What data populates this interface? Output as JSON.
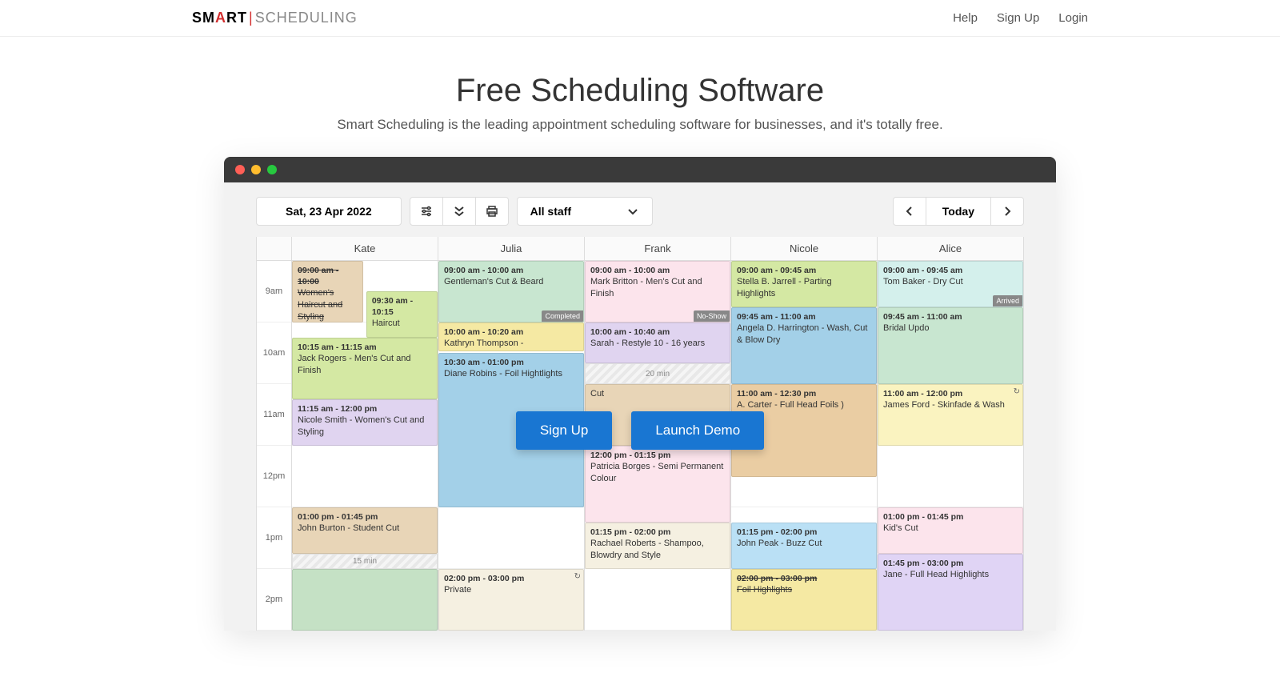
{
  "nav": {
    "help": "Help",
    "signup": "Sign Up",
    "login": "Login"
  },
  "logo": {
    "sm": "SM",
    "a": "A",
    "rt": "RT",
    "div": "|",
    "sched": "SCHEDULING"
  },
  "hero": {
    "title": "Free Scheduling Software",
    "subtitle": "Smart Scheduling is the leading appointment scheduling software for businesses, and it's totally free."
  },
  "toolbar": {
    "date": "Sat, 23 Apr 2022",
    "staff": "All staff",
    "today": "Today"
  },
  "cta": {
    "signup": "Sign Up",
    "demo": "Launch Demo"
  },
  "times": [
    "9am",
    "10am",
    "11am",
    "12pm",
    "1pm",
    "2pm"
  ],
  "staff": [
    "Kate",
    "Julia",
    "Frank",
    "Nicole",
    "Alice"
  ],
  "appts": {
    "kate": [
      {
        "time": "09:00 am - 10:00",
        "title": "Women's Haircut and Styling",
        "strike": true
      },
      {
        "time": "09:30 am - 10:15",
        "title": "Haircut"
      },
      {
        "time": "10:15 am - 11:15 am",
        "title": "Jack Rogers - Men's Cut and Finish"
      },
      {
        "time": "11:15 am - 12:00 pm",
        "title": "Nicole Smith - Women's Cut and Styling"
      },
      {
        "time": "01:00 pm - 01:45 pm",
        "title": "John Burton - Student Cut"
      }
    ],
    "kate_gap": "15 min",
    "julia": [
      {
        "time": "09:00 am - 10:00 am",
        "title": "Gentleman's Cut & Beard",
        "badge": "Completed"
      },
      {
        "time": "10:00 am - 10:20 am",
        "title": "Kathryn Thompson -"
      },
      {
        "time": "10:30 am - 01:00 pm",
        "title": "Diane Robins - Foil Hightlights"
      },
      {
        "time": "02:00 pm - 03:00 pm",
        "title": "Private"
      }
    ],
    "frank": [
      {
        "time": "09:00 am - 10:00 am",
        "title": "Mark Britton - Men's Cut and Finish",
        "badge": "No-Show"
      },
      {
        "time": "10:00 am - 10:40 am",
        "title": "Sarah - Restyle 10 - 16 years"
      },
      {
        "time": "",
        "title": "Cut"
      },
      {
        "time": "12:00 pm - 01:15 pm",
        "title": "Patricia Borges - Semi Permanent Colour"
      },
      {
        "time": "01:15 pm - 02:00 pm",
        "title": "Rachael Roberts - Shampoo, Blowdry and Style"
      }
    ],
    "frank_gap": "20 min",
    "nicole": [
      {
        "time": "09:00 am - 09:45 am",
        "title": "Stella B. Jarrell - Parting Highlights"
      },
      {
        "time": "09:45 am - 11:00 am",
        "title": "Angela D. Harrington - Wash, Cut & Blow Dry"
      },
      {
        "time": "11:00 am - 12:30 pm",
        "title": "A. Carter - Full Head Foils )"
      },
      {
        "time": "01:15 pm - 02:00 pm",
        "title": "John Peak - Buzz Cut"
      },
      {
        "time": "02:00 pm - 03:00 pm",
        "title": "Foil Highlights",
        "strike": true
      }
    ],
    "alice": [
      {
        "time": "09:00 am - 09:45 am",
        "title": "Tom Baker - Dry Cut",
        "badge": "Arrived"
      },
      {
        "time": "09:45 am - 11:00 am",
        "title": "Bridal Updo"
      },
      {
        "time": "11:00 am - 12:00 pm",
        "title": "James Ford - Skinfade & Wash"
      },
      {
        "time": "01:00 pm - 01:45 pm",
        "title": "Kid's Cut"
      },
      {
        "time": "01:45 pm - 03:00 pm",
        "title": "Jane - Full Head Highlights"
      }
    ]
  }
}
